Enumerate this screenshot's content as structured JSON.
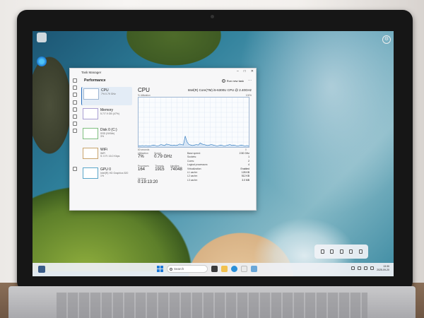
{
  "desktop": {
    "recycle_bin_label": "",
    "edge_label": ""
  },
  "task_manager": {
    "title": "Task Manager",
    "controls": [
      "–",
      "□",
      "✕"
    ],
    "section": "Performance",
    "run_new_task": "Run new task",
    "more": "···",
    "resources": [
      {
        "name": "CPU",
        "sub": "7% 0.79 GHz"
      },
      {
        "name": "Memory",
        "sub": "5.7/7.9 GB (47%)"
      },
      {
        "name": "Disk 0 (C:)",
        "sub": "SSD (NVMe)\n3%"
      },
      {
        "name": "WiFi",
        "sub": "WiFi\nS: 0 R: 16.0 Kbps"
      },
      {
        "name": "GPU 0",
        "sub": "Intel(R) HD Graphics 520\n1%"
      }
    ],
    "detail": {
      "title": "CPU",
      "model": "Intel(R) Core(TM) i5-6300U CPU @ 2.40GHz",
      "util_label": "% Utilization",
      "max_label": "100%",
      "time_label": "60 seconds",
      "min_label": "0",
      "graph_values": [
        2,
        2,
        3,
        2,
        3,
        2,
        2,
        3,
        4,
        3,
        2,
        3,
        5,
        4,
        3,
        6,
        5,
        4,
        3,
        4,
        3,
        4,
        6,
        5,
        4,
        22,
        10,
        5,
        4,
        3,
        4,
        5,
        4,
        8,
        6,
        5,
        4,
        3,
        4,
        5,
        4,
        3,
        2,
        3,
        4,
        3,
        2,
        3,
        4,
        5,
        3,
        4,
        3,
        2,
        3,
        4,
        3,
        2,
        3,
        2
      ],
      "stats": [
        {
          "label": "Utilization",
          "value": "7%"
        },
        {
          "label": "Speed",
          "value": "0.79 GHz"
        },
        {
          "label": "Processes",
          "value": "164"
        },
        {
          "label": "Threads",
          "value": "1915"
        },
        {
          "label": "Handles",
          "value": "74048"
        },
        {
          "label": "Up time",
          "value": "0:19:13:20"
        }
      ],
      "specs": [
        {
          "k": "Base speed:",
          "v": "2.50 GHz"
        },
        {
          "k": "Sockets:",
          "v": "1"
        },
        {
          "k": "Cores:",
          "v": "2"
        },
        {
          "k": "Logical processors:",
          "v": "4"
        },
        {
          "k": "Virtualization:",
          "v": "Enabled"
        },
        {
          "k": "L1 cache:",
          "v": "128 KB"
        },
        {
          "k": "L2 cache:",
          "v": "512 KB"
        },
        {
          "k": "L3 cache:",
          "v": "3.0 MB"
        }
      ]
    }
  },
  "taskbar": {
    "search_placeholder": "Search",
    "time": "13:30",
    "date": "2025-09-20"
  },
  "colors": {
    "accent": "#2a6fbf",
    "cpu_line": "#1f6fb8"
  }
}
